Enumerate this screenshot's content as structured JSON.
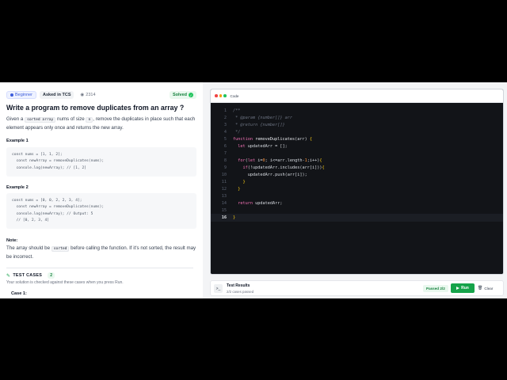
{
  "problem": {
    "level": "Beginner",
    "company": "Asked in TCS",
    "views": "2314",
    "status": "Solved",
    "title": "Write a program to remove duplicates from an array ?",
    "desc_1": "Given a",
    "desc_code_1": "sorted array",
    "desc_2": "nums of size",
    "desc_code_2": "n",
    "desc_3": ", remove the duplicates in place such that each element appears only once and returns the new array.",
    "example1_label": "Example 1",
    "example1_code": "const nums = [1, 1, 2];\n  const newArray = removeDuplicates(nums);\n  console.log(newArray); // [1, 2]",
    "example2_label": "Example 2",
    "example2_code": "const nums = [0, 0, 2, 2, 3, 4];\n  const newArray = removeDuplicates(nums);\n  console.log(newArray); // Output: 5\n  // [0, 2, 3, 4]",
    "note_label": "Note:",
    "note_1": "The array should be",
    "note_code": "sorted",
    "note_2": "before calling the function. If it's not sorted, the result may be incorrect."
  },
  "tests": {
    "heading": "TEST CASES",
    "count": "2",
    "subtitle": "Your solution is checked against these cases when you press Run.",
    "case1": "Case 1:"
  },
  "editor": {
    "title": "Code",
    "active_line": "16",
    "line_numbers": [
      "1",
      "2",
      "3",
      "4",
      "5",
      "6",
      "7",
      "8",
      "9",
      "10",
      "11",
      "12",
      "13",
      "14",
      "15",
      "16"
    ]
  },
  "results": {
    "title": "Test Results",
    "subtitle": "2/2 cases passed",
    "passed": "Passed 2/2",
    "run": "Run",
    "clear": "Clear"
  },
  "colors": {
    "run_green": "#16a34a",
    "editor_bg": "#121418",
    "traffic_red": "#ef4444",
    "traffic_yellow": "#f59e0b",
    "traffic_green": "#22c55e"
  }
}
